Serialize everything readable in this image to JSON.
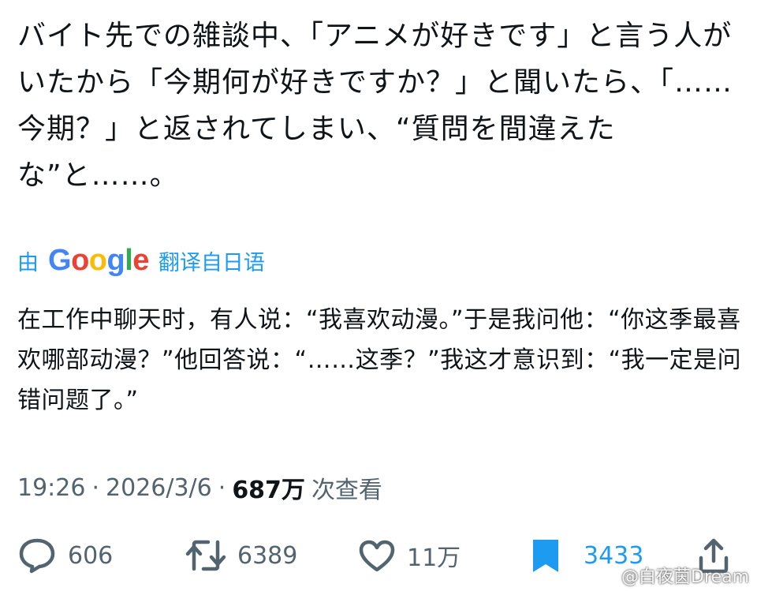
{
  "tweet": {
    "text": "バイト先での雑談中、「アニメが好きです」と言う人がいたから「今期何が好きですか？」と聞いたら、「……今期？」と返されてしまい、“質問を間違えたな”と……。"
  },
  "translation": {
    "by_label": "由",
    "google": [
      "G",
      "o",
      "o",
      "g",
      "l",
      "e"
    ],
    "google_colors": [
      "#4285F4",
      "#EA4335",
      "#FBBC05",
      "#4285F4",
      "#34A853",
      "#EA4335"
    ],
    "from_label": "翻译自日语",
    "text": "在工作中聊天时，有人说：“我喜欢动漫。”于是我问他：“你这季最喜欢哪部动漫？”他回答说：“……这季？”我这才意识到：“我一定是问错问题了。”"
  },
  "meta": {
    "time": "19:26",
    "date": "2026/3/6",
    "sep": "·",
    "views": "687万",
    "views_label": "次查看"
  },
  "actions": {
    "replies": "606",
    "reposts": "6389",
    "likes": "11万",
    "bookmarks": "3433"
  },
  "colors": {
    "accent": "#1d9bf0",
    "muted": "#536471",
    "text": "#0f1419"
  },
  "icons": [
    "reply-icon",
    "repost-icon",
    "like-icon",
    "bookmark-icon",
    "share-icon"
  ],
  "watermark": "@白夜茵Dream"
}
